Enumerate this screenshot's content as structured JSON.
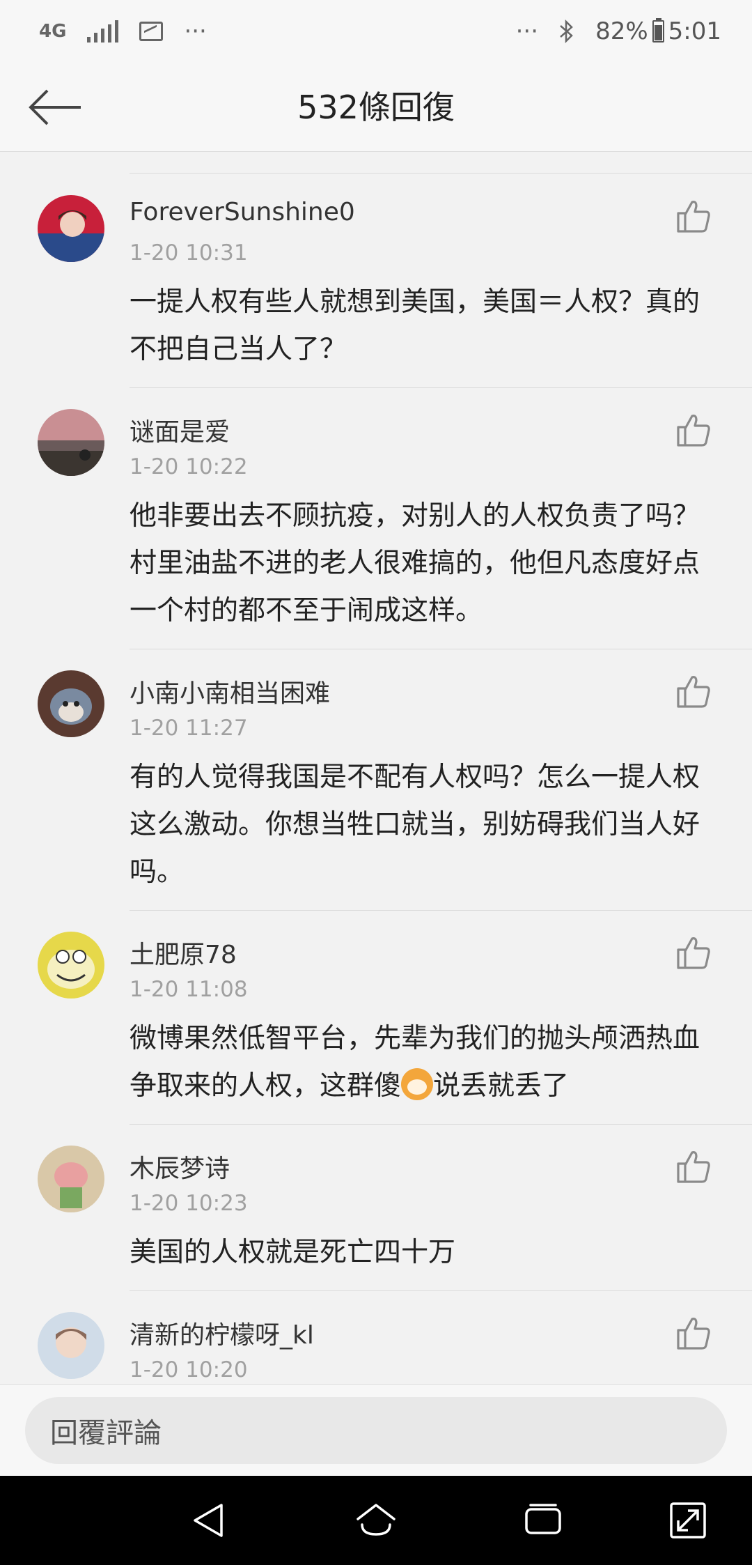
{
  "status_bar": {
    "network": "4G",
    "overflow": "···",
    "overflow_right": "···",
    "battery": "82%",
    "time": "5:01",
    "icons": [
      "signal-icon",
      "image-icon",
      "bluetooth-icon",
      "battery-icon"
    ]
  },
  "header": {
    "title": "532條回復",
    "back_icon": "back-arrow-icon"
  },
  "comments": [
    {
      "user": "ForeverSunshine0",
      "time": "1-20 10:31",
      "text": "一提人权有些人就想到美国，美国＝人权？真的不把自己当人了？",
      "avatar_colors": [
        "#c8203a",
        "#2a4a8a"
      ]
    },
    {
      "user": "谜面是爱",
      "time": "1-20 10:22",
      "text": "他非要出去不顾抗疫，对别人的人权负责了吗？村里油盐不进的老人很难搞的，他但凡态度好点一个村的都不至于闹成这样。",
      "avatar_colors": [
        "#c98f93",
        "#3b3530"
      ]
    },
    {
      "user": "小南小南相当困难",
      "time": "1-20 11:27",
      "text": "有的人觉得我国是不配有人权吗？怎么一提人权这么激动。你想当牲口就当，别妨碍我们当人好吗。",
      "avatar_colors": [
        "#5a3a30",
        "#7a8aa0"
      ]
    },
    {
      "user": "土肥原78",
      "time": "1-20 11:08",
      "text_before": "微博果然低智平台，先辈为我们的抛头颅洒热血争取来的人权，这群傻",
      "text_after": "说丢就丢了",
      "emoji": "doge-emoji",
      "avatar_colors": [
        "#e6d84a",
        "#f5f0c0"
      ]
    },
    {
      "user": "木辰梦诗",
      "time": "1-20 10:23",
      "text": "美国的人权就是死亡四十万",
      "avatar_colors": [
        "#e8a0a0",
        "#7aa860"
      ]
    },
    {
      "user": "清新的柠檬呀_kl",
      "time": "1-20 10:20",
      "text": "",
      "avatar_colors": [
        "#d0dce8",
        "#8a6a5a"
      ]
    }
  ],
  "like_icon": "thumbs-up-icon",
  "reply_bar": {
    "placeholder": "回覆評論"
  },
  "nav_bar": {
    "buttons": [
      "back-triangle-icon",
      "home-icon",
      "recent-apps-icon",
      "screen-rotate-icon"
    ]
  },
  "colors": {
    "background": "#f2f2f2",
    "text_primary": "#222222",
    "text_secondary": "#a0a0a0",
    "icon_gray": "#888888",
    "nav_bar": "#000000"
  }
}
